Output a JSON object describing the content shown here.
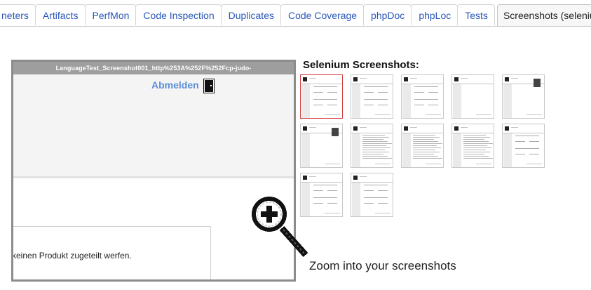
{
  "tabs": [
    {
      "label": "neters",
      "active": false
    },
    {
      "label": "Artifacts",
      "active": false
    },
    {
      "label": "PerfMon",
      "active": false
    },
    {
      "label": "Code Inspection",
      "active": false
    },
    {
      "label": "Duplicates",
      "active": false
    },
    {
      "label": "Code Coverage",
      "active": false
    },
    {
      "label": "phpDoc",
      "active": false
    },
    {
      "label": "phpLoc",
      "active": false
    },
    {
      "label": "Tests",
      "active": false
    },
    {
      "label": "Screenshots (selenium)",
      "active": true
    }
  ],
  "preview": {
    "title": "LanguageTest_Screenshot001_http%253A%252F%252Fcp-judo-",
    "logout_label": "Abmelden",
    "body_text": "keinen Produkt zugeteilt werfen."
  },
  "selenium": {
    "heading": "Selenium Screenshots:",
    "thumbnails": [
      {
        "variant": "form",
        "selected": true
      },
      {
        "variant": "form",
        "selected": false
      },
      {
        "variant": "form",
        "selected": false
      },
      {
        "variant": "empty",
        "selected": false
      },
      {
        "variant": "dark",
        "selected": false
      },
      {
        "variant": "dark",
        "selected": false
      },
      {
        "variant": "text",
        "selected": false
      },
      {
        "variant": "text",
        "selected": false
      },
      {
        "variant": "text",
        "selected": false
      },
      {
        "variant": "form",
        "selected": false
      },
      {
        "variant": "form",
        "selected": false
      },
      {
        "variant": "form",
        "selected": false
      }
    ]
  },
  "zoom_caption": "Zoom into your screenshots",
  "colors": {
    "link_blue": "#2a57b8",
    "selected_border": "#d23b3b",
    "preview_frame": "#8c8c8c"
  }
}
